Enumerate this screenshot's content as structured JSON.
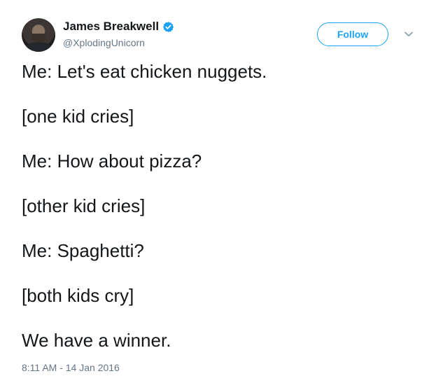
{
  "author": {
    "display_name": "James Breakwell",
    "handle": "@XplodingUnicorn",
    "verified": true,
    "verified_icon": "verified-badge-icon",
    "avatar_icon": "profile-photo"
  },
  "actions": {
    "follow_label": "Follow",
    "more_icon": "chevron-down-icon"
  },
  "tweet": {
    "lines": [
      "Me: Let's eat chicken nuggets.",
      "[one kid cries]",
      "Me: How about pizza?",
      "[other kid cries]",
      "Me: Spaghetti?",
      "[both kids cry]",
      "We have a winner."
    ],
    "timestamp": "8:11 AM - 14 Jan 2016"
  },
  "colors": {
    "accent": "#1da1f2",
    "text": "#14171a",
    "secondary_text": "#657786"
  }
}
